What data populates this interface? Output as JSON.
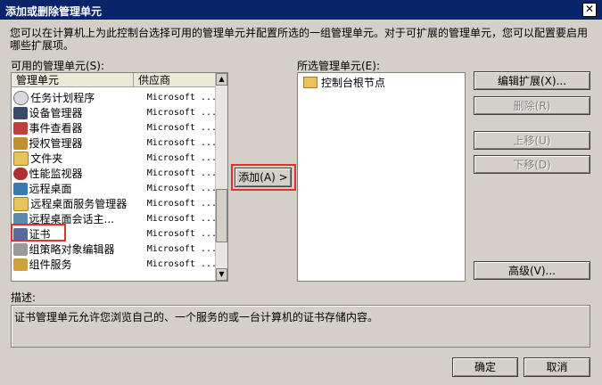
{
  "window": {
    "title": "添加或删除管理单元",
    "close_symbol": "✕"
  },
  "intro_text": "您可以在计算机上为此控制台选择可用的管理单元并配置所选的一组管理单元。对于可扩展的管理单元，您可以配置要启用哪些扩展项。",
  "available": {
    "label": "可用的管理单元(S):",
    "columns": [
      "管理单元",
      "供应商"
    ],
    "items": [
      {
        "name": "任务计划程序",
        "vendor": "Microsoft ...",
        "icon": "clock-icon"
      },
      {
        "name": "设备管理器",
        "vendor": "Microsoft ...",
        "icon": "device-icon"
      },
      {
        "name": "事件查看器",
        "vendor": "Microsoft ...",
        "icon": "event-icon"
      },
      {
        "name": "授权管理器",
        "vendor": "Microsoft ...",
        "icon": "auth-icon"
      },
      {
        "name": "文件夹",
        "vendor": "Microsoft ...",
        "icon": "folder-icon"
      },
      {
        "name": "性能监视器",
        "vendor": "Microsoft ...",
        "icon": "perf-icon"
      },
      {
        "name": "远程桌面",
        "vendor": "Microsoft ...",
        "icon": "remote-icon"
      },
      {
        "name": "远程桌面服务管理器",
        "vendor": "Microsoft ...",
        "icon": "folder-icon"
      },
      {
        "name": "远程桌面会话主...",
        "vendor": "Microsoft ...",
        "icon": "session-icon"
      },
      {
        "name": "证书",
        "vendor": "Microsoft ...",
        "icon": "certificate-icon"
      },
      {
        "name": "组策略对象编辑器",
        "vendor": "Microsoft ...",
        "icon": "policy-icon"
      },
      {
        "name": "组件服务",
        "vendor": "Microsoft ...",
        "icon": "component-icon"
      }
    ]
  },
  "add_button": "添加(A) >",
  "selected": {
    "label": "所选管理单元(E):",
    "items": [
      {
        "name": "控制台根节点",
        "icon": "folder-icon"
      }
    ]
  },
  "buttons": {
    "edit_extensions": "编辑扩展(X)...",
    "remove": "删除(R)",
    "move_up": "上移(U)",
    "move_down": "下移(D)",
    "advanced": "高级(V)..."
  },
  "description": {
    "label": "描述:",
    "text": "证书管理单元允许您浏览自己的、一个服务的或一台计算机的证书存储内容。"
  },
  "footer": {
    "ok": "确定",
    "cancel": "取消"
  }
}
